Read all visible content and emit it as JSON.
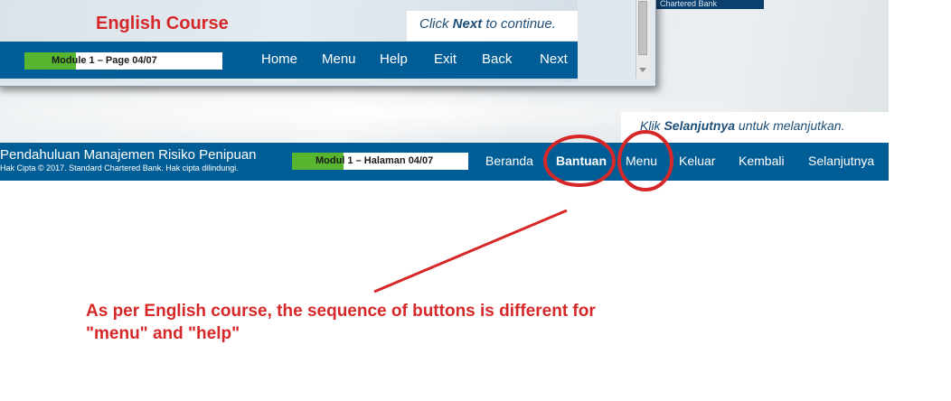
{
  "id_course": {
    "bank_tag": "Chartered Bank",
    "instruction": {
      "prefix": "Klik ",
      "emphasis": "Selanjutnya",
      "suffix": " untuk melanjutkan."
    },
    "title": "Pendahuluan Manajemen Risiko Penipuan",
    "copyright": "Hak Cipta © 2017. Standard Chartered Bank. Hak cipta dilindungi.",
    "progress": {
      "label": "Modul 1 – Halaman 04/07",
      "fraction": 0.29
    },
    "nav": {
      "home": "Beranda",
      "help": "Bantuan",
      "menu": "Menu",
      "exit": "Keluar",
      "back": "Kembali",
      "next": "Selanjutnya"
    }
  },
  "en_course": {
    "course_title": "English Course",
    "instruction": {
      "prefix": "Click ",
      "emphasis": "Next",
      "suffix": " to continue."
    },
    "progress": {
      "label": "Module 1 – Page 04/07",
      "fraction": 0.26
    },
    "nav": {
      "home": "Home",
      "menu": "Menu",
      "help": "Help",
      "exit": "Exit",
      "back": "Back",
      "next": "Next"
    }
  },
  "annotation": {
    "note_line1": "As per English course, the sequence of buttons is different for",
    "note_line2": "\"menu\" and \"help\"",
    "color": "#d62828"
  }
}
